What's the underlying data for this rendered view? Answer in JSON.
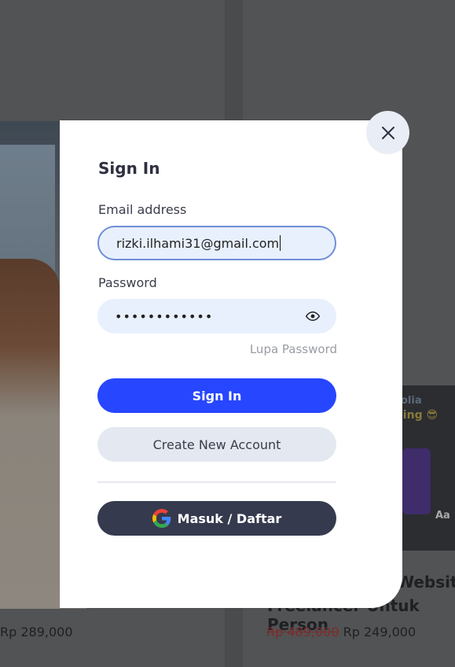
{
  "modal": {
    "title": "Sign In",
    "email_label": "Email address",
    "email_value": "rizki.ilhami31@gmail.com",
    "password_label": "Password",
    "password_masked": "••••••••••••",
    "forgot_password": "Lupa Password",
    "sign_in_button": "Sign In",
    "create_account_button": "Create New Account",
    "google_button": "Masuk / Daftar"
  },
  "background": {
    "left_card": {
      "title_fragment": "...",
      "price": "Rp 289,000"
    },
    "right_card": {
      "title_fragment_1": "Website",
      "title_fragment_2": "Freelancer Untuk Person",
      "original_price": "Rp 489,000",
      "price": "Rp 249,000",
      "thumb_text_1": "olia",
      "thumb_text_2": "ling 😎",
      "thumb_text_3": "Aa"
    }
  },
  "colors": {
    "primary": "#2746ff",
    "secondary_bg": "#e4e8f0",
    "google_bg": "#363a4e",
    "input_bg": "#e8f0fe",
    "overlay": "#4a4b4d"
  }
}
